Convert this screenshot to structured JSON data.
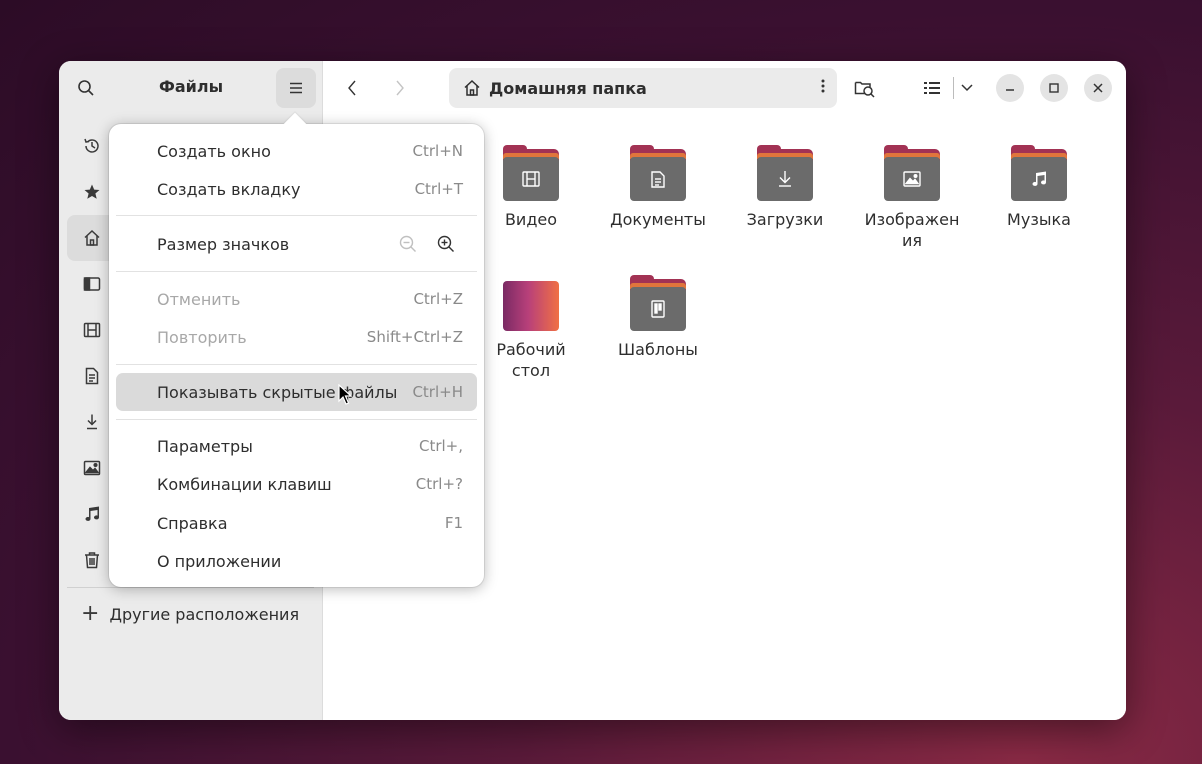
{
  "sidebar": {
    "title": "Файлы",
    "other_locations": "Другие расположения",
    "items": [
      {
        "icon": "recent-icon"
      },
      {
        "icon": "star-icon"
      },
      {
        "icon": "home-icon"
      },
      {
        "icon": "desktop-icon"
      },
      {
        "icon": "video-icon"
      },
      {
        "icon": "document-icon"
      },
      {
        "icon": "download-icon"
      },
      {
        "icon": "image-icon"
      },
      {
        "icon": "music-icon"
      },
      {
        "icon": "trash-icon"
      }
    ]
  },
  "toolbar": {
    "path": "Домашняя папка"
  },
  "files": [
    {
      "name": "Видео",
      "icon": "video-icon"
    },
    {
      "name": "Документы",
      "icon": "document-icon"
    },
    {
      "name": "Загрузки",
      "icon": "download-icon"
    },
    {
      "name": "Изображения",
      "name_display": "Изображен ия",
      "icon": "image-icon"
    },
    {
      "name": "Музыка",
      "icon": "music-icon"
    },
    {
      "name": "Рабочий стол",
      "icon": "desktop-icon"
    },
    {
      "name": "Шаблоны",
      "icon": "template-icon"
    }
  ],
  "menu": {
    "new_window": {
      "label": "Создать окно",
      "shortcut": "Ctrl+N"
    },
    "new_tab": {
      "label": "Создать вкладку",
      "shortcut": "Ctrl+T"
    },
    "icon_size": {
      "label": "Размер значков"
    },
    "undo": {
      "label": "Отменить",
      "shortcut": "Ctrl+Z"
    },
    "redo": {
      "label": "Повторить",
      "shortcut": "Shift+Ctrl+Z"
    },
    "show_hidden": {
      "label": "Показывать скрытые файлы",
      "shortcut": "Ctrl+H"
    },
    "preferences": {
      "label": "Параметры",
      "shortcut": "Ctrl+,"
    },
    "shortcuts": {
      "label": "Комбинации клавиш",
      "shortcut": "Ctrl+?"
    },
    "help": {
      "label": "Справка",
      "shortcut": "F1"
    },
    "about": {
      "label": "О приложении"
    }
  },
  "colors": {
    "folder_back": "#a23254",
    "folder_strip": "#e0753c",
    "folder_front": "#6b6b6b",
    "hover": "#dadada"
  }
}
